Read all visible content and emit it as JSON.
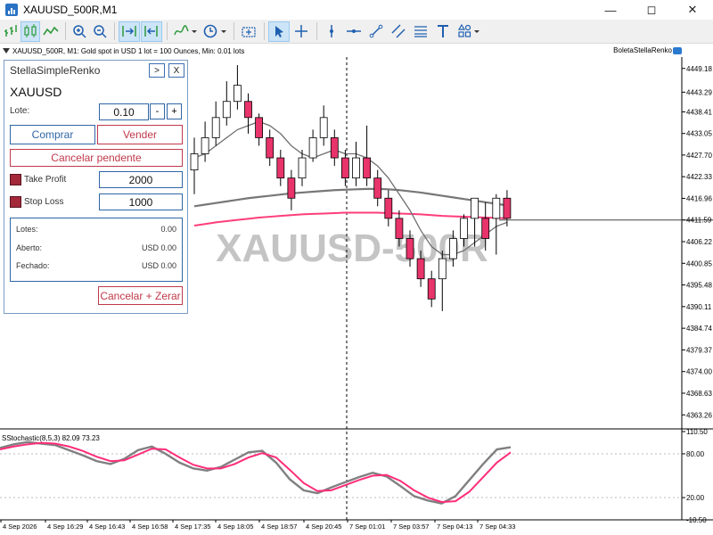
{
  "window": {
    "title": "XAUUSD_500R,M1"
  },
  "chart_info": {
    "text": "XAUUSD_500R, M1:  Gold spot in USD 1 lot = 100 Ounces, Min: 0.01 lots",
    "ea_name": "BoletaStellaRenko"
  },
  "panel": {
    "title": "StellaSimpleRenko",
    "btn_expand": ">",
    "btn_close": "X",
    "symbol": "XAUUSD",
    "lot_label": "Lote:",
    "lot_value": "0.10",
    "lot_minus": "-",
    "lot_plus": "+",
    "buy_label": "Comprar",
    "sell_label": "Vender",
    "cancel_pending_label": "Cancelar pendente",
    "tp_label": "Take Profit",
    "tp_value": "2000",
    "sl_label": "Stop Loss",
    "sl_value": "1000",
    "summary": [
      {
        "label": "Lotes:",
        "value": "0.00"
      },
      {
        "label": "Aberto:",
        "value": "USD 0.00"
      },
      {
        "label": "Fechado:",
        "value": "USD 0.00"
      }
    ],
    "cancel_close_label": "Cancelar + Zerar"
  },
  "watermark": "XAUUSD-500R",
  "price_axis": [
    "4449.18",
    "4443.29",
    "4438.41",
    "4433.05",
    "4427.70",
    "4422.33",
    "4416.96",
    "4411.59",
    "4406.22",
    "4400.85",
    "4395.48",
    "4390.11",
    "4384.74",
    "4379.37",
    "4374.00",
    "4368.63",
    "4363.26"
  ],
  "current_price": "4411.59",
  "time_axis": [
    "4 Sep 2026",
    "4 Sep 16:29",
    "4 Sep 16:43",
    "4 Sep 16:58",
    "4 Sep 17:35",
    "4 Sep 18:05",
    "4 Sep 18:57",
    "4 Sep 20:45",
    "7 Sep 01:01",
    "7 Sep 03:57",
    "7 Sep 04:13",
    "7 Sep 04:33"
  ],
  "indicator": {
    "label": "SStochastic(8,5,3) 82.09 73.23",
    "levels": [
      "110.50",
      "80.00",
      "20.00",
      "-10.50"
    ]
  },
  "colors": {
    "bull": "#ffffff",
    "bear": "#e8336b",
    "fast_ma": "#707070",
    "slow_ma": "#777777",
    "pink_ma": "#ff3d7a",
    "stoch_main": "#808080",
    "stoch_signal": "#ff2d78",
    "watermark": "#c4c4c4"
  },
  "chart_data": {
    "type": "candlestick",
    "candles": [
      {
        "o": 4424,
        "c": 4428,
        "h": 4432,
        "l": 4418
      },
      {
        "o": 4428,
        "c": 4432,
        "h": 4436,
        "l": 4426
      },
      {
        "o": 4432,
        "c": 4437,
        "h": 4441,
        "l": 4430
      },
      {
        "o": 4437,
        "c": 4441,
        "h": 4446,
        "l": 4435
      },
      {
        "o": 4441,
        "c": 4445,
        "h": 4450,
        "l": 4439
      },
      {
        "o": 4441,
        "c": 4437,
        "h": 4443,
        "l": 4433
      },
      {
        "o": 4437,
        "c": 4432,
        "h": 4438,
        "l": 4430
      },
      {
        "o": 4432,
        "c": 4427,
        "h": 4434,
        "l": 4425
      },
      {
        "o": 4427,
        "c": 4422,
        "h": 4429,
        "l": 4420
      },
      {
        "o": 4422,
        "c": 4417,
        "h": 4424,
        "l": 4414
      },
      {
        "o": 4422,
        "c": 4427,
        "h": 4429,
        "l": 4420
      },
      {
        "o": 4427,
        "c": 4432,
        "h": 4434,
        "l": 4426
      },
      {
        "o": 4432,
        "c": 4437,
        "h": 4440,
        "l": 4430
      },
      {
        "o": 4432,
        "c": 4427,
        "h": 4434,
        "l": 4425
      },
      {
        "o": 4427,
        "c": 4422,
        "h": 4429,
        "l": 4420
      },
      {
        "o": 4422,
        "c": 4427,
        "h": 4431,
        "l": 4420
      },
      {
        "o": 4427,
        "c": 4422,
        "h": 4435,
        "l": 4420
      },
      {
        "o": 4422,
        "c": 4417,
        "h": 4424,
        "l": 4415
      },
      {
        "o": 4417,
        "c": 4412,
        "h": 4419,
        "l": 4410
      },
      {
        "o": 4412,
        "c": 4407,
        "h": 4414,
        "l": 4405
      },
      {
        "o": 4407,
        "c": 4402,
        "h": 4409,
        "l": 4400
      },
      {
        "o": 4402,
        "c": 4397,
        "h": 4404,
        "l": 4395
      },
      {
        "o": 4397,
        "c": 4392,
        "h": 4399,
        "l": 4390
      },
      {
        "o": 4397,
        "c": 4402,
        "h": 4404,
        "l": 4389
      },
      {
        "o": 4402,
        "c": 4407,
        "h": 4409,
        "l": 4400
      },
      {
        "o": 4407,
        "c": 4412,
        "h": 4413,
        "l": 4405
      },
      {
        "o": 4412,
        "c": 4417,
        "h": 4417,
        "l": 4405
      },
      {
        "o": 4412,
        "c": 4407,
        "h": 4416,
        "l": 4404
      },
      {
        "o": 4412,
        "c": 4417,
        "h": 4418,
        "l": 4403
      },
      {
        "o": 4417,
        "c": 4412,
        "h": 4419,
        "l": 4410
      }
    ],
    "fast_ma": [
      4427,
      4428,
      4430,
      4432,
      4434,
      4435,
      4436,
      4435,
      4433,
      4430,
      4428,
      4427,
      4428,
      4429,
      4428,
      4428,
      4427,
      4425,
      4422,
      4418,
      4414,
      4409,
      4405,
      4403,
      4403,
      4404,
      4406,
      4408,
      4410,
      4411
    ],
    "slow_ma": [
      4415,
      4415.4,
      4415.8,
      4416.2,
      4416.6,
      4417,
      4417.3,
      4417.6,
      4417.9,
      4418.2,
      4418.4,
      4418.6,
      4418.8,
      4419,
      4419.1,
      4419.2,
      4419.3,
      4419.3,
      4419.2,
      4419,
      4418.7,
      4418.4,
      4418,
      4417.6,
      4417.2,
      4416.8,
      4416.4,
      4416,
      4415.6,
      4415.2
    ],
    "pink_ma": [
      4410.2,
      4410.6,
      4411,
      4411.3,
      4411.6,
      4411.9,
      4412.2,
      4412.4,
      4412.6,
      4412.8,
      4413,
      4413.1,
      4413.2,
      4413.3,
      4413.4,
      4413.4,
      4413.4,
      4413.4,
      4413.3,
      4413.2,
      4413.1,
      4413,
      4412.8,
      4412.6,
      4412.5,
      4412.4,
      4412.3,
      4412.2,
      4412.1,
      4412
    ],
    "stoch_main": [
      88,
      93,
      96,
      94,
      92,
      85,
      78,
      70,
      66,
      73,
      85,
      90,
      80,
      68,
      60,
      57,
      62,
      72,
      82,
      84,
      68,
      45,
      30,
      26,
      34,
      41,
      48,
      54,
      49,
      36,
      22,
      16,
      12,
      22,
      44,
      66,
      86,
      89
    ],
    "stoch_signal": [
      86,
      90,
      93,
      95,
      94,
      90,
      84,
      76,
      70,
      71,
      79,
      87,
      86,
      75,
      65,
      60,
      60,
      66,
      75,
      81,
      75,
      58,
      40,
      29,
      30,
      37,
      44,
      50,
      51,
      43,
      30,
      20,
      14,
      15,
      28,
      48,
      68,
      82
    ],
    "ylim": [
      4360,
      4452
    ],
    "stoch_ylim": [
      -10.5,
      110.5
    ]
  }
}
